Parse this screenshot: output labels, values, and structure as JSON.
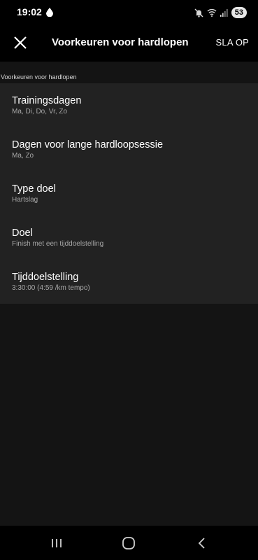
{
  "status_bar": {
    "time": "19:02",
    "battery": "53"
  },
  "header": {
    "title": "Voorkeuren voor hardlopen",
    "save_label": "SLA OP"
  },
  "section": {
    "label": "Voorkeuren voor hardlopen"
  },
  "items": [
    {
      "title": "Trainingsdagen",
      "subtitle": "Ma, Di, Do, Vr, Zo"
    },
    {
      "title": "Dagen voor lange hardloopsessie",
      "subtitle": "Ma, Zo"
    },
    {
      "title": "Type doel",
      "subtitle": "Hartslag"
    },
    {
      "title": "Doel",
      "subtitle": "Finish met een tijddoelstelling"
    },
    {
      "title": "Tijddoelstelling",
      "subtitle": "3:30:00 (4:59 /km tempo)"
    }
  ],
  "icons": {
    "status": [
      "water-drop-icon",
      "mute-icon",
      "wifi-icon",
      "signal-icon",
      "battery-icon"
    ],
    "header": [
      "close-icon"
    ],
    "nav": [
      "recent-apps-icon",
      "home-icon",
      "back-icon"
    ]
  }
}
